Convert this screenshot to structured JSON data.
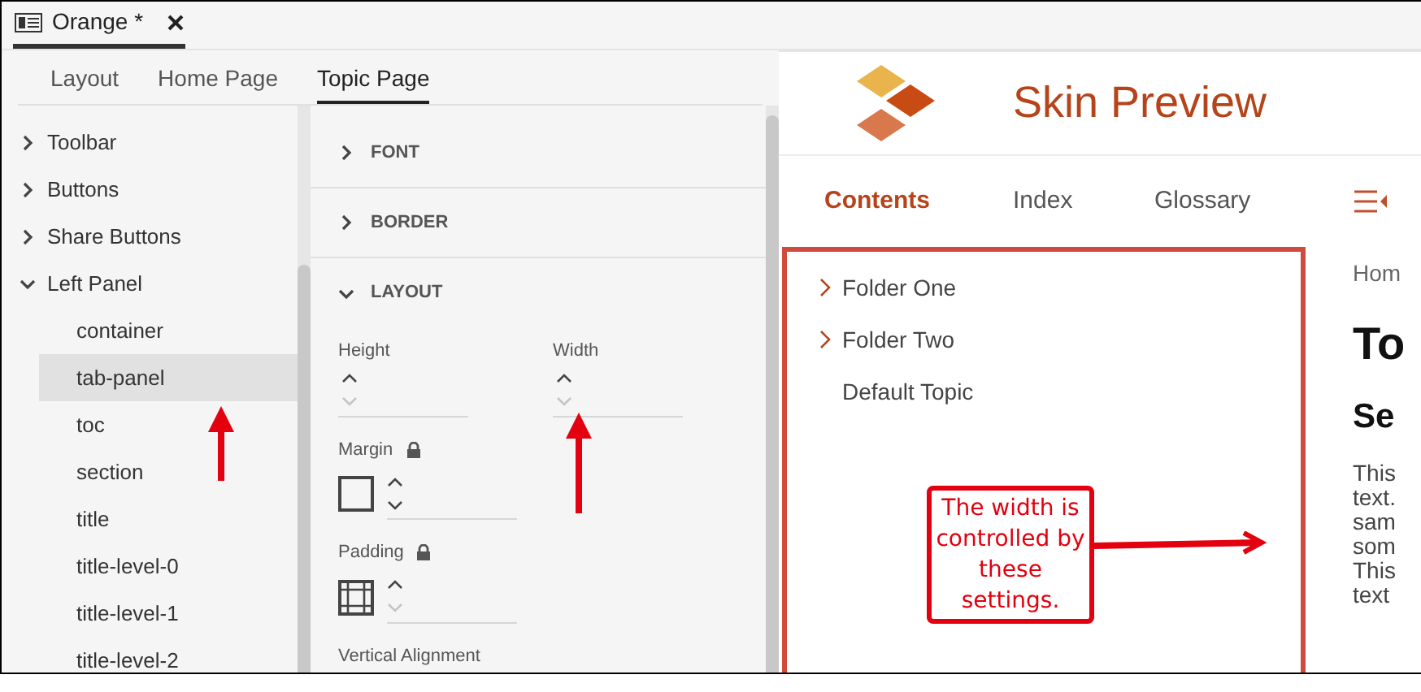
{
  "document_tab": {
    "title": "Orange *",
    "selected": true
  },
  "subtabs": [
    {
      "label": "Layout",
      "selected": false
    },
    {
      "label": "Home Page",
      "selected": false
    },
    {
      "label": "Topic Page",
      "selected": true
    }
  ],
  "tree": [
    {
      "label": "Toolbar",
      "expanded": false
    },
    {
      "label": "Buttons",
      "expanded": false
    },
    {
      "label": "Share Buttons",
      "expanded": false
    },
    {
      "label": "Left Panel",
      "expanded": true,
      "children": [
        {
          "label": "container",
          "selected": false
        },
        {
          "label": "tab-panel",
          "selected": true
        },
        {
          "label": "toc",
          "selected": false
        },
        {
          "label": "section",
          "selected": false
        },
        {
          "label": "title",
          "selected": false
        },
        {
          "label": "title-level-0",
          "selected": false
        },
        {
          "label": "title-level-1",
          "selected": false
        },
        {
          "label": "title-level-2",
          "selected": false
        }
      ]
    }
  ],
  "sections": [
    {
      "label": "FONT",
      "expanded": false
    },
    {
      "label": "BORDER",
      "expanded": false
    },
    {
      "label": "LAYOUT",
      "expanded": true
    }
  ],
  "layout": {
    "size_fields": [
      {
        "label": "Height",
        "down_disabled": true
      },
      {
        "label": "Width",
        "down_disabled": true
      }
    ],
    "box_fields": [
      {
        "label": "Margin",
        "kind": "margin",
        "down_disabled": false
      },
      {
        "label": "Padding",
        "kind": "padding",
        "down_disabled": true
      }
    ],
    "next_label": "Vertical Alignment"
  },
  "preview": {
    "title": "Skin Preview",
    "tabs": [
      {
        "label": "Contents",
        "selected": true
      },
      {
        "label": "Index",
        "selected": false
      },
      {
        "label": "Glossary",
        "selected": false
      }
    ],
    "toc": [
      {
        "label": "Folder One",
        "kind": "folder"
      },
      {
        "label": "Folder Two",
        "kind": "folder"
      },
      {
        "label": "Default Topic",
        "kind": "topic"
      }
    ],
    "breadcrumb": "Hom",
    "heading": "To",
    "subheading": "Se",
    "body_lines": [
      "This",
      "text.",
      "sam",
      "som",
      "This",
      "text"
    ]
  },
  "callout": "The width is controlled by these settings."
}
